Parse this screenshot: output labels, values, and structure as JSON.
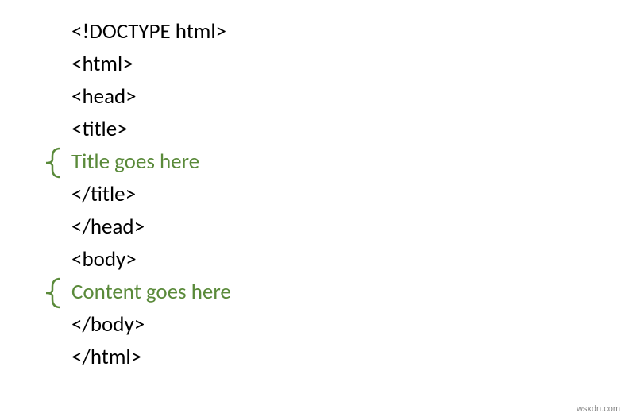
{
  "code": {
    "line1": "<!DOCTYPE html>",
    "line2": "<html>",
    "line3": "<head>",
    "line4": "<title>",
    "line5": "Title goes here",
    "line6": "</title>",
    "line7": "</head>",
    "line8": "<body>",
    "line9": "Content goes here",
    "line10": "</body>",
    "line11": "</html>"
  },
  "watermark": "wsxdn.com",
  "colors": {
    "text": "#000000",
    "desc": "#5a8a3a",
    "bracket": "#5a8a3a"
  }
}
